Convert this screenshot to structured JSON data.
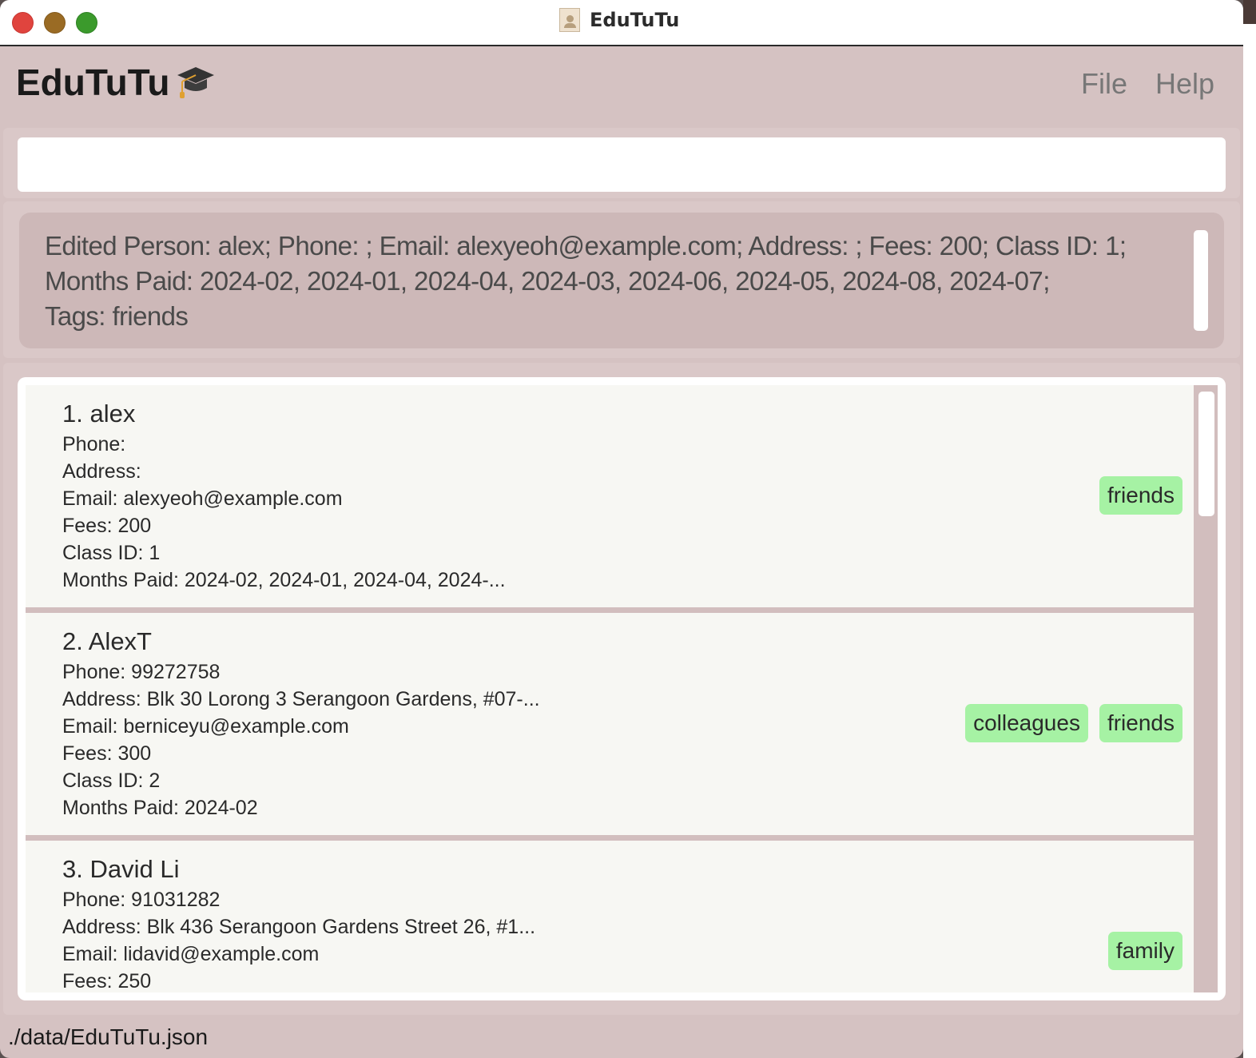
{
  "window": {
    "title": "EduTuTu"
  },
  "menubar": {
    "brand": "EduTuTu",
    "menus": [
      "File",
      "Help"
    ]
  },
  "command_box": {
    "value": "",
    "placeholder": ""
  },
  "result_display": {
    "lines": [
      "Edited Person: alex; Phone: ; Email: alexyeoh@example.com; Address: ; Fees: 200; Class ID: 1;",
      "Months Paid: 2024-02, 2024-01, 2024-04, 2024-03, 2024-06, 2024-05, 2024-08, 2024-07;",
      "Tags: friends"
    ]
  },
  "persons": [
    {
      "name": "1. alex",
      "phone": "Phone:",
      "address": "Address:",
      "email": "Email:  alexyeoh@example.com",
      "fees": "Fees:  200",
      "class_id": "Class ID:  1",
      "months_paid": "Months Paid:  2024-02, 2024-01, 2024-04, 2024-...",
      "tags": [
        "friends"
      ]
    },
    {
      "name": "2. AlexT",
      "phone": "Phone:  99272758",
      "address": "Address:  Blk 30 Lorong 3 Serangoon Gardens, #07-...",
      "email": "Email:  berniceyu@example.com",
      "fees": "Fees:  300",
      "class_id": "Class ID:  2",
      "months_paid": "Months Paid:  2024-02",
      "tags": [
        "colleagues",
        "friends"
      ]
    },
    {
      "name": "3. David Li",
      "phone": "Phone:  91031282",
      "address": "Address:  Blk 436 Serangoon Gardens Street 26, #1...",
      "email": "Email:  lidavid@example.com",
      "fees": "Fees:  250",
      "tags": [
        "family"
      ]
    }
  ],
  "status_bar": {
    "file_path": "./data/EduTuTu.json"
  },
  "colors": {
    "background": "#d5c2c2",
    "card": "#f7f7f3",
    "tag": "#a6f2a4"
  },
  "icons": {
    "brand_icon": "graduation-cap-icon",
    "title_icon": "document-icon"
  }
}
